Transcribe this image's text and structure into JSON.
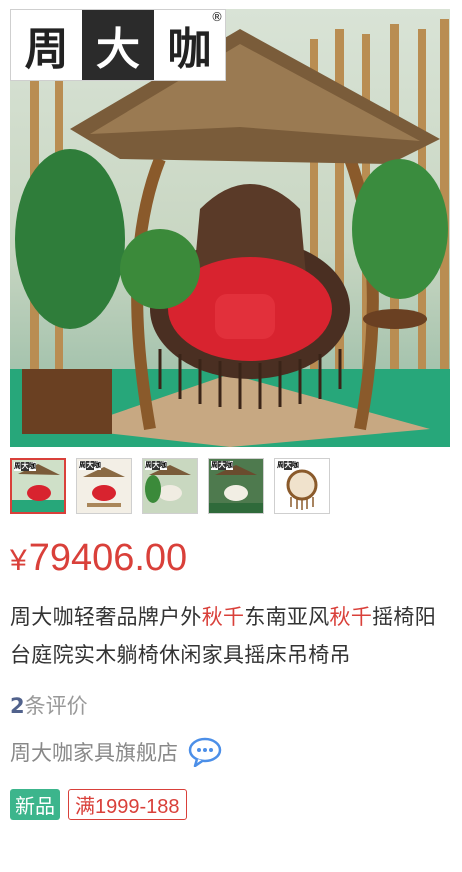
{
  "logo": {
    "chars": [
      "周",
      "大",
      "咖"
    ],
    "reg": "®"
  },
  "thumbnails": [
    {
      "name": "thumb-1",
      "active": true
    },
    {
      "name": "thumb-2",
      "active": false
    },
    {
      "name": "thumb-3",
      "active": false
    },
    {
      "name": "thumb-4",
      "active": false
    },
    {
      "name": "thumb-5",
      "active": false
    }
  ],
  "price": {
    "currency": "¥",
    "amount": "79406.00",
    "color": "#d9403a"
  },
  "title": {
    "segments": [
      {
        "text": "周大咖轻奢品牌户外",
        "highlight": false
      },
      {
        "text": "秋千",
        "highlight": true
      },
      {
        "text": "东南亚风",
        "highlight": false
      },
      {
        "text": "秋千",
        "highlight": true
      },
      {
        "text": "摇椅阳台庭院实木躺椅休闲家具摇床吊椅吊",
        "highlight": false
      }
    ]
  },
  "reviews": {
    "count": "2",
    "label": "条评价"
  },
  "shop": {
    "name": "周大咖家具旗舰店",
    "icon": "chat-bubble-icon"
  },
  "tags": {
    "new": "新品",
    "promo": "满1999-188"
  },
  "colors": {
    "accent": "#d9403a",
    "new_tag": "#3cb58c",
    "review_num": "#51628c"
  }
}
